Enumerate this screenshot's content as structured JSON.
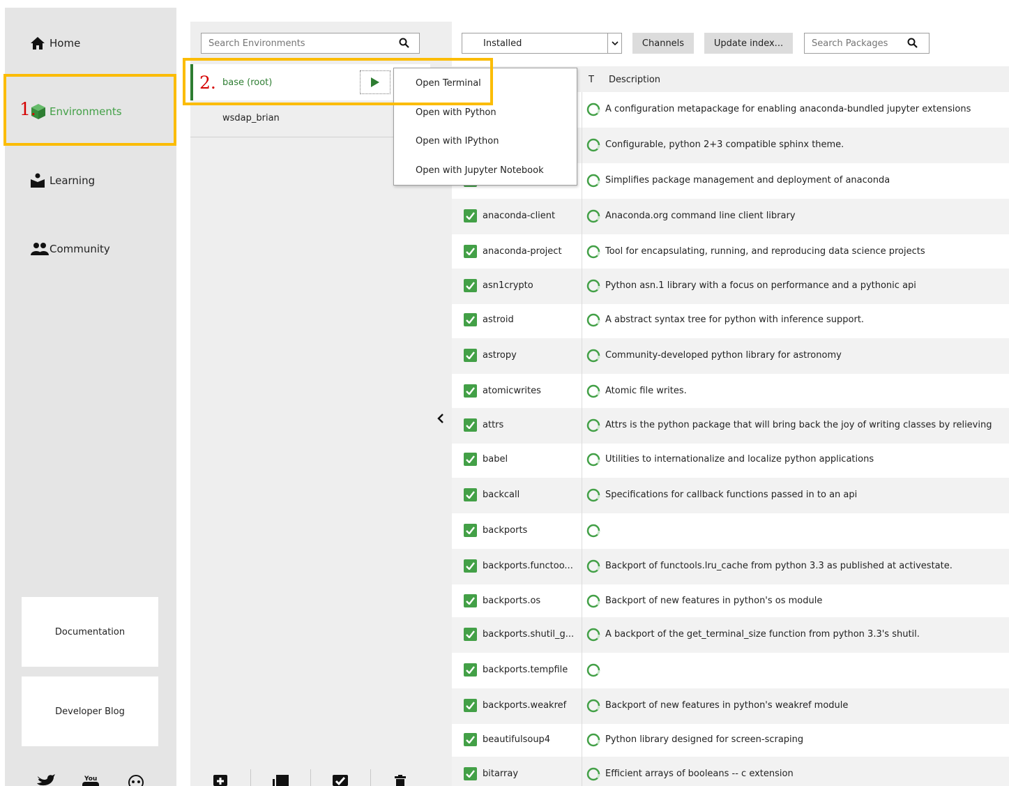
{
  "nav": {
    "items": [
      {
        "label": "Home",
        "icon": "home-icon"
      },
      {
        "label": "Environments",
        "icon": "cube-icon"
      },
      {
        "label": "Learning",
        "icon": "book-reader-icon"
      },
      {
        "label": "Community",
        "icon": "people-icon"
      }
    ],
    "cards": [
      {
        "label": "Documentation"
      },
      {
        "label": "Developer Blog"
      }
    ],
    "social": [
      "twitter-icon",
      "youtube-icon",
      "github-icon"
    ]
  },
  "environments": {
    "search_placeholder": "Search Environments",
    "items": [
      {
        "label": "base (root)",
        "selected": true
      },
      {
        "label": "wsdap_brian",
        "selected": false
      }
    ],
    "toolbar_icons": [
      "create-icon",
      "clone-icon",
      "import-icon",
      "remove-icon"
    ]
  },
  "context_menu": {
    "items": [
      {
        "label": "Open Terminal"
      },
      {
        "label": "Open with Python"
      },
      {
        "label": "Open with IPython"
      },
      {
        "label": "Open with Jupyter Notebook"
      }
    ]
  },
  "packages": {
    "filter": "Installed",
    "channels_label": "Channels",
    "update_label": "Update index...",
    "search_placeholder": "Search Packages",
    "header": {
      "type": "T",
      "description": "Description"
    },
    "rows": [
      {
        "name": "",
        "description": "A configuration metapackage for enabling anaconda-bundled jupyter extensions"
      },
      {
        "name": "",
        "description": "Configurable, python 2+3 compatible sphinx theme."
      },
      {
        "name": "",
        "description": "Simplifies package management and deployment of anaconda"
      },
      {
        "name": "anaconda-client",
        "description": "Anaconda.org command line client library"
      },
      {
        "name": "anaconda-project",
        "description": "Tool for encapsulating, running, and reproducing data science projects"
      },
      {
        "name": "asn1crypto",
        "description": "Python asn.1 library with a focus on performance and a pythonic api"
      },
      {
        "name": "astroid",
        "description": "A abstract syntax tree for python with inference support."
      },
      {
        "name": "astropy",
        "description": "Community-developed python library for astronomy"
      },
      {
        "name": "atomicwrites",
        "description": "Atomic file writes."
      },
      {
        "name": "attrs",
        "description": "Attrs is the python package that will bring back the joy of writing classes by relieving"
      },
      {
        "name": "babel",
        "description": "Utilities to internationalize and localize python applications"
      },
      {
        "name": "backcall",
        "description": "Specifications for callback functions passed in to an api"
      },
      {
        "name": "backports",
        "description": ""
      },
      {
        "name": "backports.functoo...",
        "description": "Backport of functools.lru_cache from python 3.3 as published at activestate."
      },
      {
        "name": "backports.os",
        "description": "Backport of new features in python's os module"
      },
      {
        "name": "backports.shutil_g...",
        "description": "A backport of the get_terminal_size function from python 3.3's shutil."
      },
      {
        "name": "backports.tempfile",
        "description": ""
      },
      {
        "name": "backports.weakref",
        "description": "Backport of new features in python's weakref module"
      },
      {
        "name": "beautifulsoup4",
        "description": "Python library designed for screen-scraping"
      },
      {
        "name": "bitarray",
        "description": "Efficient arrays of booleans -- c extension"
      }
    ]
  },
  "annotations": {
    "step1": "1.",
    "step2": "2.",
    "highlight_color": "#fbbc05",
    "step_color": "#d50000"
  }
}
